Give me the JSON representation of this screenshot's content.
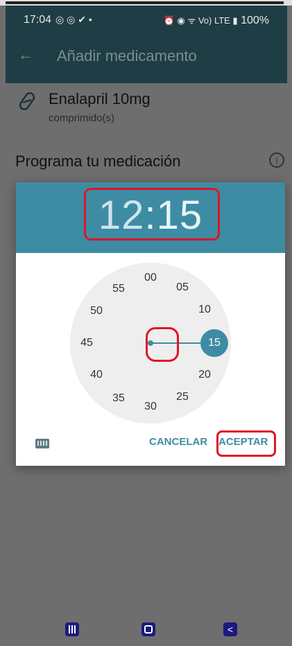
{
  "status_bar": {
    "time": "17:04",
    "notification_icons": "◎ ◎ ✔ •",
    "system_icons": "⏰ ◉ ᯤ Vo) LTE ▮",
    "battery": "100%"
  },
  "toolbar": {
    "back_icon": "arrow-left",
    "title": "Añadir medicamento"
  },
  "medication": {
    "icon": "pill",
    "name": "Enalapril 10mg",
    "form": "comprimido(s)"
  },
  "section": {
    "title": "Programa tu medicación",
    "info_icon": "info"
  },
  "time_picker": {
    "hours": "12",
    "separator": ":",
    "minutes": "15",
    "selected_minute": "15",
    "dial_labels": [
      "00",
      "05",
      "10",
      "15",
      "20",
      "25",
      "30",
      "35",
      "40",
      "45",
      "50",
      "55"
    ],
    "keyboard_icon": "keyboard",
    "cancel_label": "CANCELAR",
    "ok_label": "ACEPTAR"
  },
  "nav_bar": {
    "recent_icon": "recent-apps",
    "home_icon": "home",
    "back_icon": "back"
  },
  "colors": {
    "header": "#1f3d44",
    "accent": "#3d8ca3",
    "overlay": "#6e6e6e",
    "annotation": "#e0142a"
  }
}
